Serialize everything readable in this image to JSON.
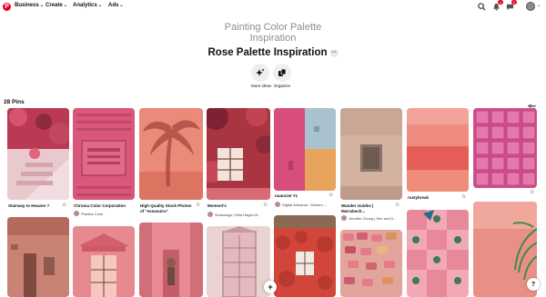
{
  "nav": {
    "logo": "P",
    "business": "Business",
    "create": "Create",
    "analytics": "Analytics",
    "ads": "Ads",
    "notifications_badge": "1",
    "messages_badge": "1"
  },
  "board": {
    "parent_title_line1": "Painting Color Palette",
    "parent_title_line2": "Inspiration",
    "title": "Rose Palette Inspiration",
    "more": "···",
    "actions": [
      {
        "label": "More ideas",
        "icon": "sparkle-icon"
      },
      {
        "label": "Organize",
        "icon": "organize-icon"
      }
    ],
    "pin_count": "28 Pins"
  },
  "pins": [
    {
      "caption": "Stairway to Heaven ?",
      "source": ""
    },
    {
      "caption": "Chroma Color Corporation",
      "source": "Plastics Color"
    },
    {
      "caption": "High Quality Stock Photos",
      "caption2": "of \"essaouira\"",
      "source": ""
    },
    {
      "caption": "Moment's",
      "source": "Sinanaogu | Mira Hagen-B..."
    },
    {
      "caption": "nuancier #1",
      "source": "Digital Artisanat - Modern ..."
    },
    {
      "caption": "Wander Guides |",
      "caption2": "Marrakech...",
      "source": "Jennifer Chong | See and D..."
    },
    {
      "caption": "rustybreak",
      "source": ""
    },
    {
      "caption": "",
      "source": ""
    }
  ],
  "colors": {
    "brand": "#e60023",
    "pin1": "#c65a6c",
    "pin2": "#d8577a",
    "pin3": "#e58674",
    "pin4": "#b9434d",
    "pin5": "#e15a86",
    "pin6": "#d4b2a2",
    "pin7": "#ec7b6e",
    "pin8": "#d24f8e"
  },
  "fab_add": "+",
  "help": "?"
}
